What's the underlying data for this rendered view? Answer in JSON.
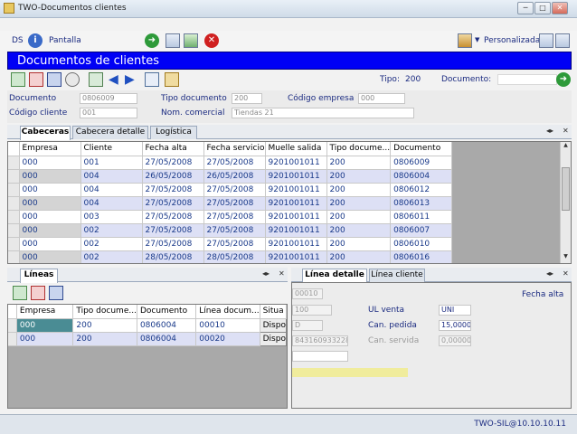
{
  "window": {
    "title": "TWO-Documentos clientes"
  },
  "toolbar": {
    "ds_label": "DS",
    "pantalla_label": "Pantalla",
    "personalizada_label": "Personalizada"
  },
  "header": {
    "title": "Documentos de clientes",
    "tipo_label": "Tipo:",
    "tipo_value": "200",
    "documento_label": "Documento:"
  },
  "filters": {
    "documento_label": "Documento",
    "documento_value": "0806009",
    "tipo_documento_label": "Tipo documento",
    "tipo_documento_value": "200",
    "codigo_empresa_label": "Código empresa",
    "codigo_empresa_value": "000",
    "codigo_cliente_label": "Código cliente",
    "codigo_cliente_value": "001",
    "nombre_comercial_label": "Nom. comercial",
    "nombre_comercial_value": "Tiendas 21"
  },
  "tabs_main": [
    "Cabeceras",
    "Cabecera detalle",
    "Logística"
  ],
  "cabeceras": {
    "columns": [
      "Empresa",
      "Cliente",
      "Fecha alta",
      "Fecha servicio",
      "Muelle salida",
      "Tipo docume...",
      "Documento"
    ],
    "rows": [
      [
        "000",
        "001",
        "27/05/2008",
        "27/05/2008",
        "9201001011",
        "200",
        "0806009"
      ],
      [
        "000",
        "004",
        "26/05/2008",
        "26/05/2008",
        "9201001011",
        "200",
        "0806004"
      ],
      [
        "000",
        "004",
        "27/05/2008",
        "27/05/2008",
        "9201001011",
        "200",
        "0806012"
      ],
      [
        "000",
        "004",
        "27/05/2008",
        "27/05/2008",
        "9201001011",
        "200",
        "0806013"
      ],
      [
        "000",
        "003",
        "27/05/2008",
        "27/05/2008",
        "9201001011",
        "200",
        "0806011"
      ],
      [
        "000",
        "002",
        "27/05/2008",
        "27/05/2008",
        "9201001011",
        "200",
        "0806007"
      ],
      [
        "000",
        "002",
        "27/05/2008",
        "27/05/2008",
        "9201001011",
        "200",
        "0806010"
      ],
      [
        "000",
        "002",
        "28/05/2008",
        "28/05/2008",
        "9201001011",
        "200",
        "0806016"
      ]
    ]
  },
  "lineas": {
    "tab_label": "Líneas",
    "columns": [
      "Empresa",
      "Tipo docume...",
      "Documento",
      "Línea docum...",
      "Situa"
    ],
    "rows": [
      [
        "000",
        "200",
        "0806004",
        "00010",
        "Dispo"
      ],
      [
        "000",
        "200",
        "0806004",
        "00020",
        "Dispo"
      ]
    ]
  },
  "detalle": {
    "tabs": [
      "Línea detalle",
      "Línea cliente"
    ],
    "field1": "00010",
    "fecha_alta_label": "Fecha alta",
    "field2": "100",
    "ul_venta_label": "UL venta",
    "ul_venta_value": "UNI",
    "field3": "D",
    "can_pedida_label": "Can. pedida",
    "can_pedida_value": "15,00000",
    "field4": "8431609332285",
    "can_servida_label": "Can. servida",
    "can_servida_value": "0,000000"
  },
  "status": {
    "connection": "TWO-SIL@10.10.10.11"
  }
}
